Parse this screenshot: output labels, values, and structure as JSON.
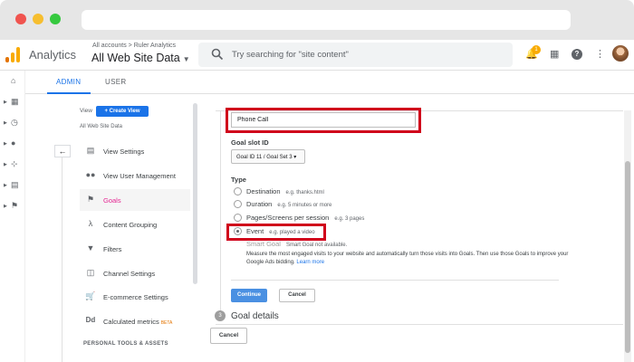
{
  "header": {
    "app_name": "Analytics",
    "breadcrumb": "All accounts > Ruler Analytics",
    "property": "All Web Site Data",
    "search_placeholder": "Try searching for \"site content\"",
    "notification_count": "1"
  },
  "tabs": [
    {
      "label": "ADMIN",
      "active": true
    },
    {
      "label": "USER",
      "active": false
    }
  ],
  "rail": {
    "icons": [
      "home-icon",
      "dashboard-icon",
      "clock-icon",
      "person-icon",
      "acquisition-icon",
      "behavior-icon",
      "flag-icon"
    ]
  },
  "view_panel": {
    "view_label": "View",
    "create_view": "Create View",
    "view_name": "All Web Site Data",
    "items": [
      {
        "label": "View Settings",
        "icon": "document-icon"
      },
      {
        "label": "View User Management",
        "icon": "users-icon"
      },
      {
        "label": "Goals",
        "icon": "flag-icon",
        "active": true
      },
      {
        "label": "Content Grouping",
        "icon": "grouping-icon"
      },
      {
        "label": "Filters",
        "icon": "filter-icon"
      },
      {
        "label": "Channel Settings",
        "icon": "channel-icon"
      },
      {
        "label": "E-commerce Settings",
        "icon": "cart-icon"
      },
      {
        "label": "Calculated metrics",
        "icon": "dd-icon",
        "badge": "BETA"
      }
    ],
    "section_label": "PERSONAL TOOLS & ASSETS"
  },
  "goal_form": {
    "goal_name_value": "Phone Call",
    "slot_label": "Goal slot ID",
    "slot_value": "Goal ID 11 / Goal Set 3",
    "type_label": "Type",
    "types": [
      {
        "label": "Destination",
        "example": "e.g. thanks.html",
        "checked": false
      },
      {
        "label": "Duration",
        "example": "e.g. 5 minutes or more",
        "checked": false
      },
      {
        "label": "Pages/Screens per session",
        "example": "e.g. 3 pages",
        "checked": false
      },
      {
        "label": "Event",
        "example": "e.g. played a video",
        "checked": true
      }
    ],
    "smart_goal_label": "Smart Goal",
    "smart_goal_note": "Smart Goal not available.",
    "smart_goal_desc": "Measure the most engaged visits to your website and automatically turn those visits into Goals. Then use those Goals to improve your Google Ads bidding.",
    "learn_more": "Learn more",
    "continue_label": "Continue",
    "cancel_label": "Cancel",
    "step_number": "3",
    "goal_details": "Goal details",
    "bottom_cancel": "Cancel"
  },
  "colors": {
    "accent": "#1a73e8",
    "highlight": "#d0021b",
    "active_goal": "#e52592"
  }
}
